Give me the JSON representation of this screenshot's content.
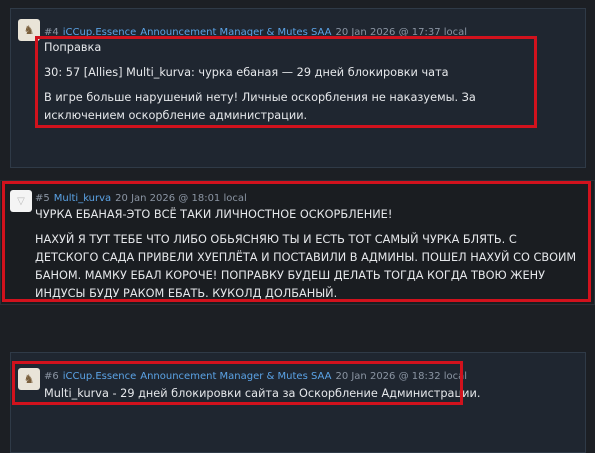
{
  "posts": [
    {
      "number": "#4",
      "user": "iCCup.Essence",
      "roles": "Announcement Manager & Mutes SAA",
      "date": "20 Jan 2026 @ 17:37 local",
      "lines": [
        "Поправка",
        "30: 57 [Allies] Multi_kurva: чурка ебаная — 29 дней блокировки чата",
        "В игре больше нарушений нету! Личные оскорбления не наказуемы. За исключением оскорбление администрации."
      ]
    },
    {
      "number": "#5",
      "user": "Multi_kurva",
      "roles": "",
      "date": "20 Jan 2026 @ 18:01 local",
      "lines": [
        "ЧУРКА ЕБАНАЯ-ЭТО ВСЁ ТАКИ ЛИЧНОСТНОЕ ОСКОРБЛЕНИЕ!",
        "НАХУЙ Я ТУТ ТЕБЕ ЧТО ЛИБО ОБЬЯСНЯЮ ТЫ И ЕСТЬ ТОТ САМЫЙ ЧУРКА БЛЯТЬ. С ДЕТСКОГО САДА ПРИВЕЛИ ХУЕПЛЁТА И ПОСТАВИЛИ В АДМИНЫ. ПОШЕЛ НАХУЙ СО СВОИМ БАНОМ. МАМКУ ЕБАЛ КОРОЧЕ! ПОПРАВКУ БУДЕШ ДЕЛАТЬ ТОГДА КОГДА ТВОЮ ЖЕНУ ИНДУСЫ БУДУ РАКОМ ЕБАТЬ. КУКОЛД ДОЛБАНЫЙ."
      ]
    },
    {
      "number": "#6",
      "user": "iCCup.Essence",
      "roles": "Announcement Manager & Mutes SAA",
      "date": "20 Jan 2026 @ 18:32 local",
      "lines": [
        "Multi_kurva - 29 дней блокировки сайта за Оскорбление Администрации."
      ]
    }
  ],
  "colors": {
    "background": "#1c1f24",
    "post_bg": "#1f2630",
    "username": "#5ba3e6",
    "highlight": "#d1121d"
  },
  "icons": {
    "avatar_4": "essence-avatar-icon",
    "avatar_5": "default-avatar-icon",
    "avatar_6": "essence-avatar-icon"
  }
}
